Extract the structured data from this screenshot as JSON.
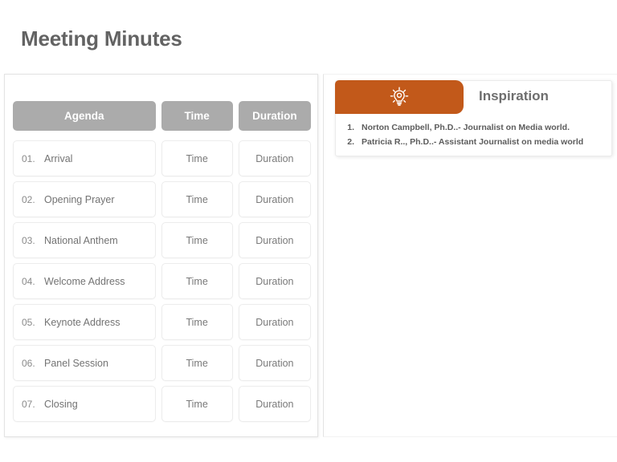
{
  "page": {
    "title": "Meeting Minutes"
  },
  "agenda": {
    "columns": [
      {
        "key": "agenda",
        "label": "Agenda"
      },
      {
        "key": "time",
        "label": "Time"
      },
      {
        "key": "duration",
        "label": "Duration"
      }
    ],
    "rows": [
      {
        "num": "01.",
        "label": "Arrival",
        "time": "Time",
        "duration": "Duration"
      },
      {
        "num": "02.",
        "label": "Opening Prayer",
        "time": "Time",
        "duration": "Duration"
      },
      {
        "num": "03.",
        "label": "National Anthem",
        "time": "Time",
        "duration": "Duration"
      },
      {
        "num": "04.",
        "label": "Welcome Address",
        "time": "Time",
        "duration": "Duration"
      },
      {
        "num": "05.",
        "label": "Keynote Address",
        "time": "Time",
        "duration": "Duration"
      },
      {
        "num": "06.",
        "label": "Panel Session",
        "time": "Time",
        "duration": "Duration"
      },
      {
        "num": "07.",
        "label": "Closing",
        "time": "Time",
        "duration": "Duration"
      }
    ]
  },
  "inspiration": {
    "title": "Inspiration",
    "icon": "lightbulb-icon",
    "items": [
      {
        "num": "1.",
        "text": "Norton Campbell, Ph.D..- Journalist on Media world."
      },
      {
        "num": "2.",
        "text": "Patricia R.., Ph.D..- Assistant Journalist on media world"
      }
    ]
  },
  "colors": {
    "accent_orange": "#c2591a",
    "header_gray": "#ababab",
    "title_gray": "#636363",
    "body_text_gray": "#737373",
    "cell_border": "#ececec"
  }
}
